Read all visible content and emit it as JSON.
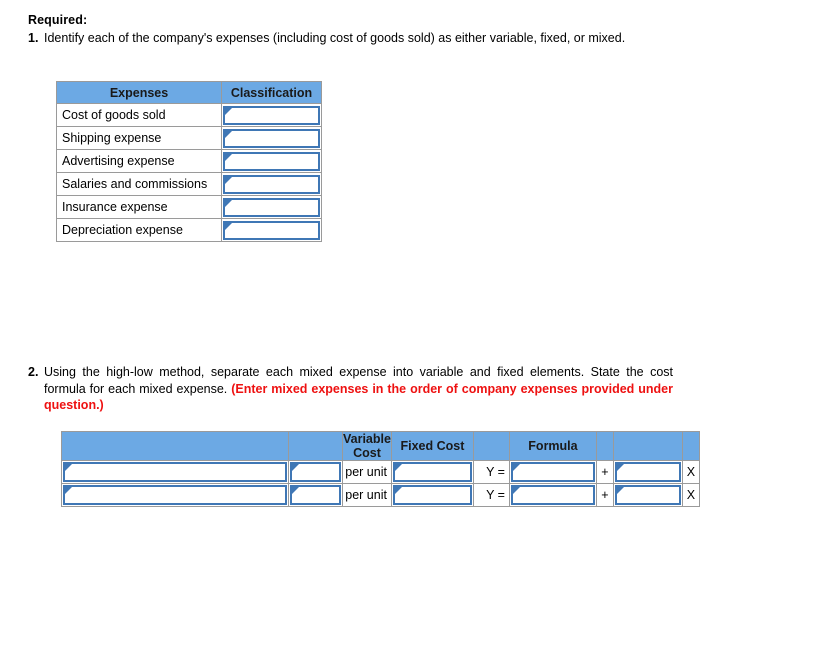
{
  "page": {
    "required_label": "Required:"
  },
  "questions": [
    {
      "number": "1.",
      "text": "Identify each of the company's expenses (including cost of goods sold) as either variable, fixed, or mixed."
    },
    {
      "number": "2.",
      "text": "Using the high-low method, separate each mixed expense into variable and fixed elements. State the cost formula for each mixed expense. ",
      "note": "(Enter mixed expenses in the order of company expenses provided under question.)"
    }
  ],
  "expense_table": {
    "headers": [
      "Expenses",
      "Classification"
    ],
    "rows": [
      {
        "expense": "Cost of goods sold",
        "classification": ""
      },
      {
        "expense": "Shipping expense",
        "classification": ""
      },
      {
        "expense": "Advertising expense",
        "classification": ""
      },
      {
        "expense": "Salaries and commissions",
        "classification": ""
      },
      {
        "expense": "Insurance expense",
        "classification": ""
      },
      {
        "expense": "Depreciation expense",
        "classification": ""
      }
    ]
  },
  "formula_table": {
    "headers": {
      "name": "",
      "variable_cost": "Variable Cost",
      "fixed_cost": "Fixed Cost",
      "formula": "Formula"
    },
    "labels": {
      "per_unit": "per unit",
      "y_equals": "Y =",
      "plus": "+",
      "times": "X"
    },
    "rows": [
      {
        "name": "",
        "variable_cost": "",
        "fixed_cost": "",
        "formula_fixed": "",
        "formula_variable": ""
      },
      {
        "name": "",
        "variable_cost": "",
        "fixed_cost": "",
        "formula_fixed": "",
        "formula_variable": ""
      }
    ]
  },
  "colors": {
    "header_blue": "#6CA9E4",
    "field_border_blue": "#3F77B5",
    "note_red": "#ee1111",
    "grid_gray": "#9a9a9a"
  }
}
